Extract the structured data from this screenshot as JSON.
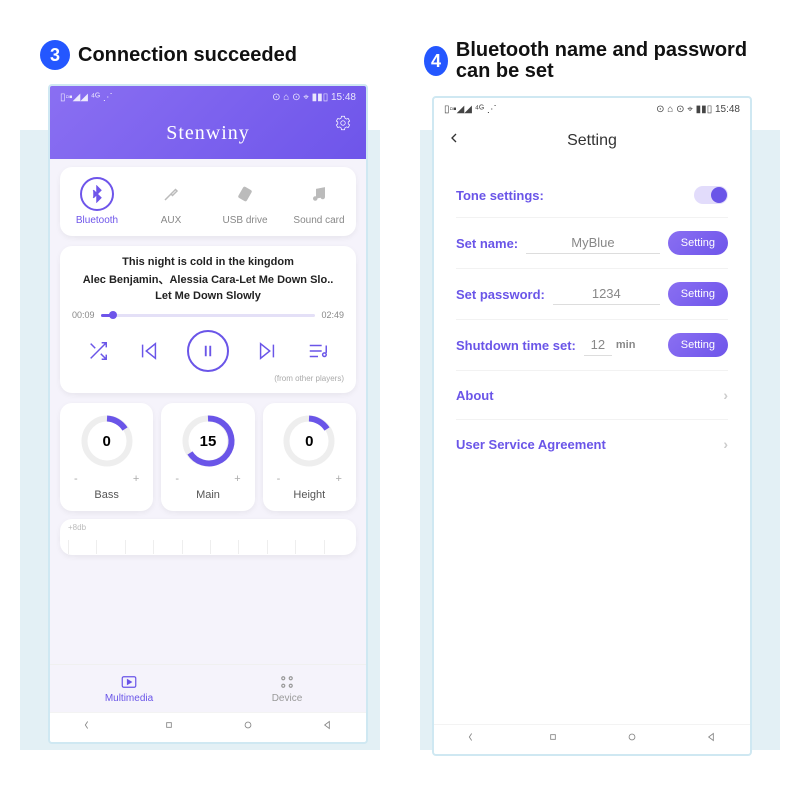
{
  "step3": {
    "num": "3",
    "title": "Connection succeeded"
  },
  "step4": {
    "num": "4",
    "title": "Bluetooth name and password can be set"
  },
  "status": {
    "left_icons": "▯▫▪◢◢ ⁴ᴳ ⋰",
    "right": "⊙ ⌂ ⊙ ⌖ ▮▮▯ 15:48"
  },
  "left": {
    "brand": "Stenwiny",
    "sources": {
      "bt": "Bluetooth",
      "aux": "AUX",
      "usb": "USB drive",
      "snd": "Sound card"
    },
    "player": {
      "line1": "This night is cold in the kingdom",
      "line2": "Alec Benjamin、Alessia Cara-Let Me Down Slo..",
      "line3": "Let Me Down Slowly",
      "cur": "00:09",
      "dur": "02:49",
      "from_other": "(from other players)"
    },
    "dials": {
      "bass_val": "0",
      "bass_label": "Bass",
      "main_val": "15",
      "main_label": "Main",
      "height_val": "0",
      "height_label": "Height",
      "minus": "-",
      "plus": "+"
    },
    "eq_label": "+8db",
    "tabs": {
      "multimedia": "Multimedia",
      "device": "Device"
    }
  },
  "right": {
    "title": "Setting",
    "tone_label": "Tone settings:",
    "name_label": "Set name:",
    "name_value": "MyBlue",
    "pass_label": "Set password:",
    "pass_value": "1234",
    "shut_label": "Shutdown time set:",
    "shut_value": "12",
    "shut_unit": "min",
    "setting_btn": "Setting",
    "about": "About",
    "agreement": "User Service Agreement"
  }
}
